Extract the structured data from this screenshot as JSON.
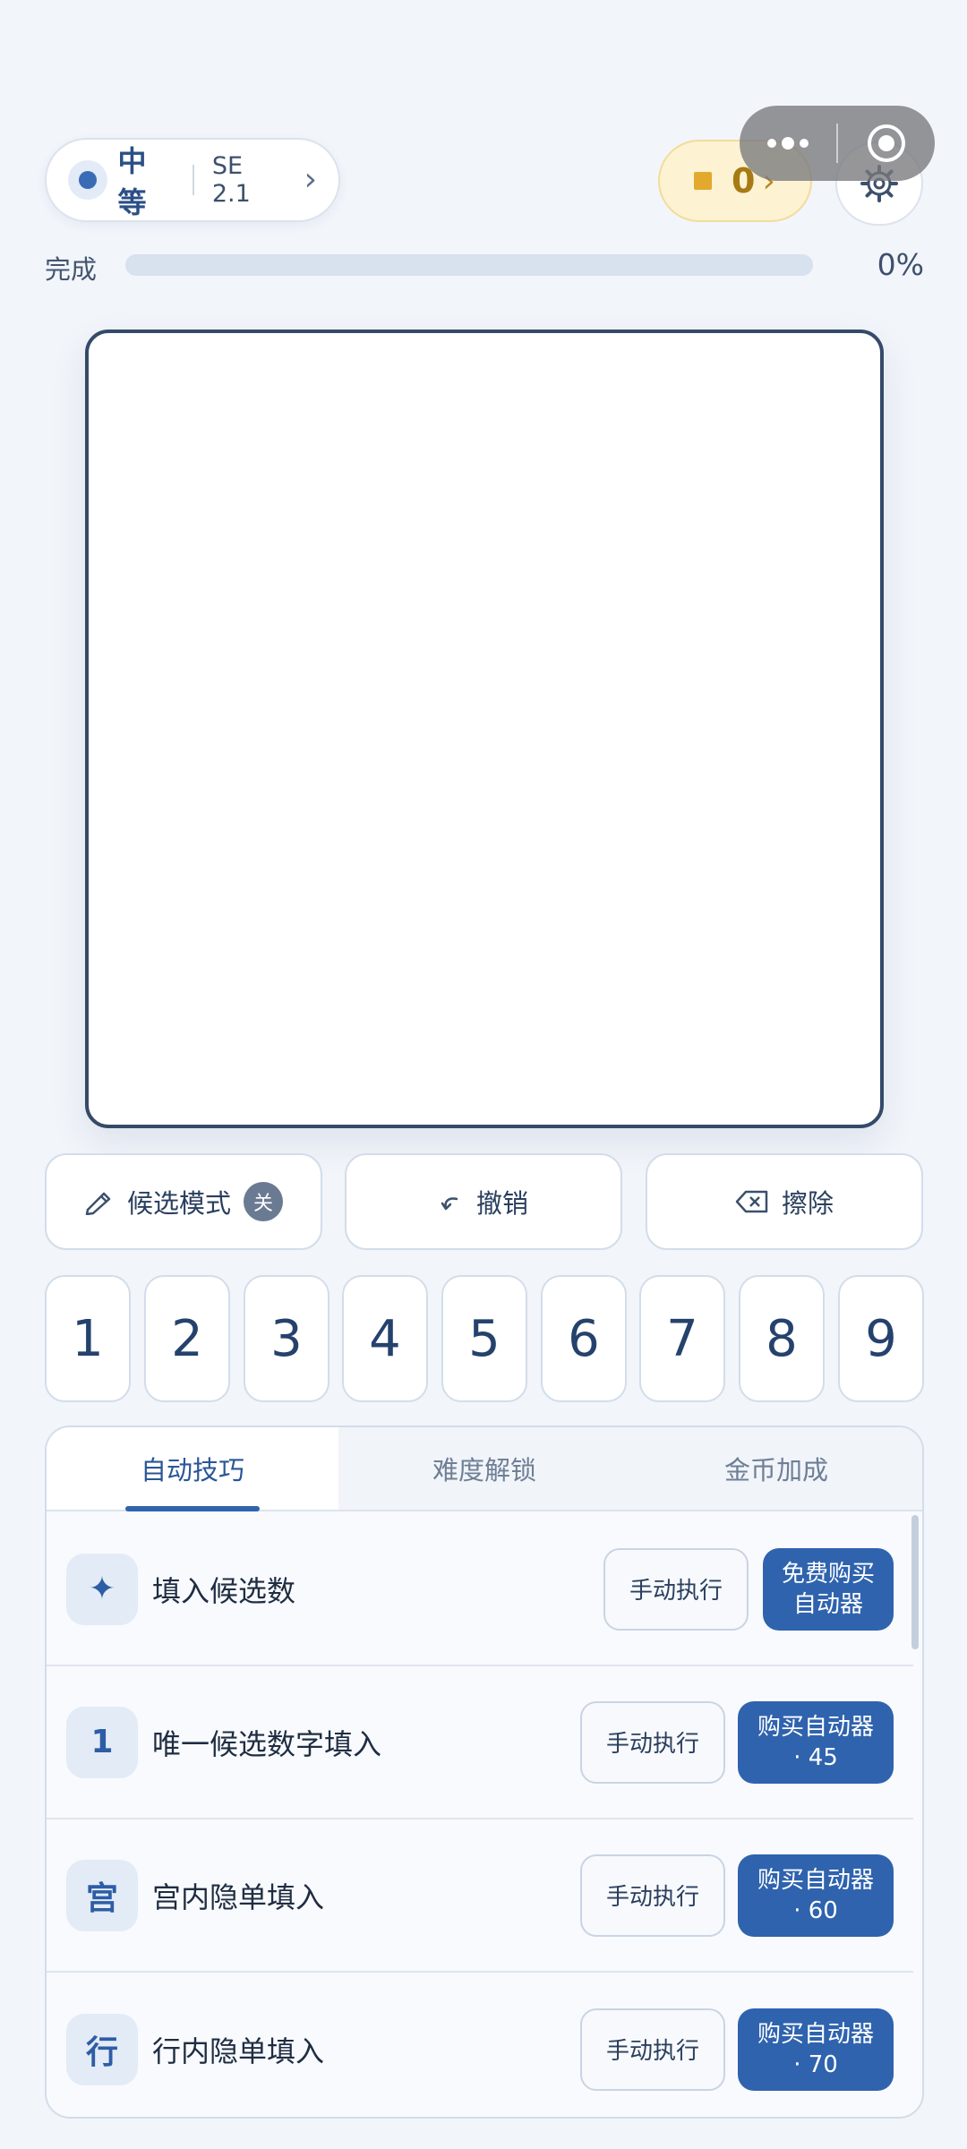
{
  "header": {
    "difficulty": "中等",
    "se_rating": "SE 2.1",
    "chevron": "›",
    "coins": "0",
    "coin_chevron": "›"
  },
  "progress": {
    "label": "完成",
    "value": 0,
    "value_text": "0%"
  },
  "toolbar": {
    "candidate_label": "候选模式",
    "candidate_state": "关",
    "undo_label": "撤销",
    "erase_label": "擦除"
  },
  "numpad": [
    "1",
    "2",
    "3",
    "4",
    "5",
    "6",
    "7",
    "8",
    "9"
  ],
  "tabs": [
    {
      "label": "自动技巧",
      "active": true
    },
    {
      "label": "难度解锁",
      "active": false
    },
    {
      "label": "金币加成",
      "active": false
    }
  ],
  "skills": [
    {
      "icon": "✦",
      "icon_name": "sparkle-icon",
      "label": "填入候选数",
      "manual": "手动执行",
      "buy_line1": "免费购买",
      "buy_line2": "自动器"
    },
    {
      "icon": "1",
      "icon_name": "digit-one-icon",
      "label": "唯一候选数字填入",
      "manual": "手动执行",
      "buy_line1": "购买自动器",
      "buy_line2": "· 45"
    },
    {
      "icon": "宫",
      "icon_name": "box-icon",
      "label": "宫内隐单填入",
      "manual": "手动执行",
      "buy_line1": "购买自动器",
      "buy_line2": "· 60"
    },
    {
      "icon": "行",
      "icon_name": "row-icon",
      "label": "行内隐单填入",
      "manual": "手动执行",
      "buy_line1": "购买自动器",
      "buy_line2": "· 70"
    }
  ],
  "colors": {
    "accent": "#2f63ae",
    "background": "#f2f5fa",
    "coin": "#e2a92c"
  }
}
